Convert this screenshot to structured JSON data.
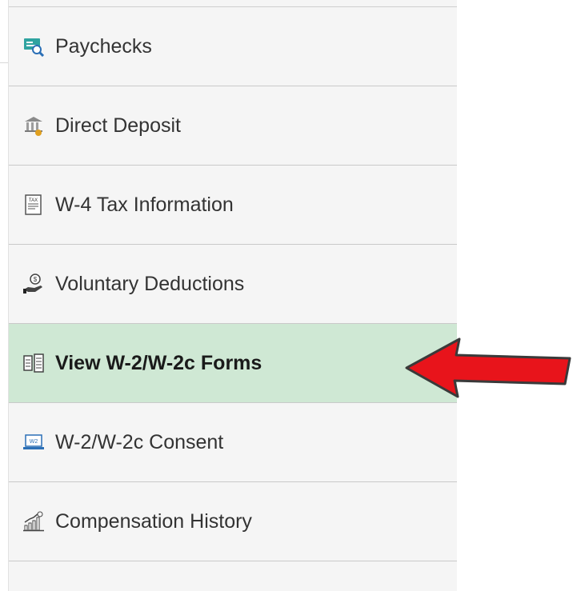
{
  "menu": {
    "items": [
      {
        "label": "Paychecks",
        "icon": "paycheck-search-icon",
        "active": false
      },
      {
        "label": "Direct Deposit",
        "icon": "bank-icon",
        "active": false
      },
      {
        "label": "W-4 Tax Information",
        "icon": "tax-form-icon",
        "active": false
      },
      {
        "label": "Voluntary Deductions",
        "icon": "hand-dollar-icon",
        "active": false
      },
      {
        "label": "View W-2/W-2c Forms",
        "icon": "forms-icon",
        "active": true
      },
      {
        "label": "W-2/W-2c Consent",
        "icon": "w2-laptop-icon",
        "active": false
      },
      {
        "label": "Compensation History",
        "icon": "chart-growth-icon",
        "active": false
      }
    ]
  },
  "colors": {
    "active_background": "#cfe8d4",
    "panel_background": "#f5f5f5",
    "arrow": "#e8141b"
  },
  "icon_text": {
    "tax": "TAX",
    "w2": "W2"
  }
}
